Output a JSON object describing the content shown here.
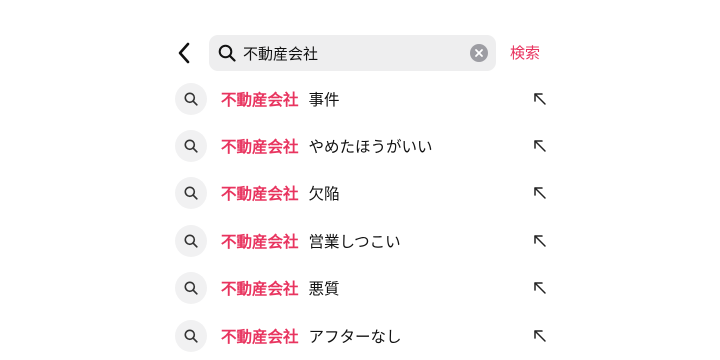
{
  "search": {
    "query": "不動産会社",
    "submit_label": "検索"
  },
  "icons": {
    "back": "chevron-left-icon",
    "search": "search-icon",
    "clear": "clear-icon",
    "fill": "arrow-up-left-icon"
  },
  "colors": {
    "accent": "#e8345f",
    "field_background": "#eeeeef",
    "icon_circle": "#f1f1f2"
  },
  "suggestions": [
    {
      "match": "不動産会社",
      "rest": "事件"
    },
    {
      "match": "不動産会社",
      "rest": "やめたほうがいい"
    },
    {
      "match": "不動産会社",
      "rest": "欠陥"
    },
    {
      "match": "不動産会社",
      "rest": "営業しつこい"
    },
    {
      "match": "不動産会社",
      "rest": "悪質"
    },
    {
      "match": "不動産会社",
      "rest": "アフターなし"
    }
  ]
}
